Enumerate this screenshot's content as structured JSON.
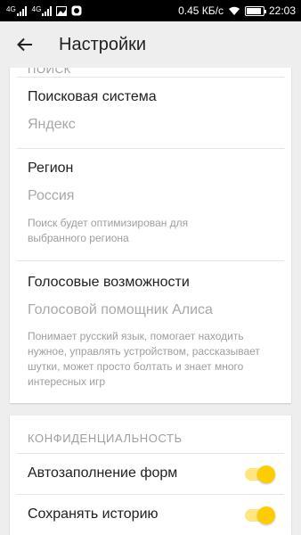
{
  "status_bar": {
    "signal1_label": "4G",
    "signal2_label": "4G",
    "speed": "0.45 КБ/с",
    "time": "22:03",
    "battery_level": 0.9
  },
  "app_bar": {
    "title": "Настройки"
  },
  "search_section": {
    "header": "ПОИСК",
    "engine_label": "Поисковая система",
    "engine_value": "Яндекс",
    "region_label": "Регион",
    "region_value": "Россия",
    "region_hint": "Поиск будет оптимизирован для выбранного региона",
    "voice_label": "Голосовые возможности",
    "voice_value": "Голосовой помощник Алиса",
    "voice_hint": "Понимает русский язык, помогает находить нужное, управлять устройством, рассказывает шутки, может просто болтать и знает много интересных игр"
  },
  "privacy_section": {
    "header": "КОНФИДЕНЦИАЛЬНОСТЬ",
    "autofill_label": "Автозаполнение форм",
    "autofill_on": true,
    "history_label": "Сохранять историю",
    "history_on": true
  },
  "colors": {
    "accent": "#ffcc00",
    "track": "#ffe680"
  }
}
